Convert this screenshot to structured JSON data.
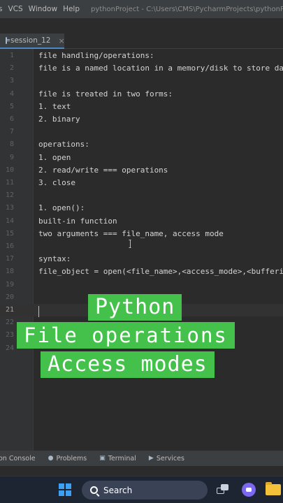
{
  "menu": {
    "items": [
      "s",
      "VCS",
      "Window",
      "Help"
    ],
    "title": "pythonProject - C:\\Users\\CMS\\PycharmProjects\\pythonProject"
  },
  "tab": {
    "label": "session_12",
    "close": "×"
  },
  "editor": {
    "lines": [
      {
        "num": "1",
        "code": "file handling/operations:"
      },
      {
        "num": "2",
        "code": "file is a named location in a memory/disk to store data"
      },
      {
        "num": "3",
        "code": ""
      },
      {
        "num": "4",
        "code": "file is treated in two forms:"
      },
      {
        "num": "5",
        "code": "1. text"
      },
      {
        "num": "6",
        "code": "2. binary"
      },
      {
        "num": "7",
        "code": ""
      },
      {
        "num": "8",
        "code": "operations:"
      },
      {
        "num": "9",
        "code": "1. open"
      },
      {
        "num": "10",
        "code": "2. read/write === operations"
      },
      {
        "num": "11",
        "code": "3. close"
      },
      {
        "num": "12",
        "code": ""
      },
      {
        "num": "13",
        "code": "1. open():"
      },
      {
        "num": "14",
        "code": "built-in function"
      },
      {
        "num": "15",
        "code": "two arguments === file_name, access mode"
      },
      {
        "num": "16",
        "code": ""
      },
      {
        "num": "17",
        "code": "syntax:"
      },
      {
        "num": "18",
        "code": "file_object = open(<file_name>,<access_mode>,<buffering>)"
      },
      {
        "num": "19",
        "code": ""
      },
      {
        "num": "20",
        "code": ""
      },
      {
        "num": "21",
        "code": ""
      },
      {
        "num": "22",
        "code": ""
      },
      {
        "num": "23",
        "code": ""
      },
      {
        "num": "24",
        "code": ""
      }
    ],
    "current_line": "21"
  },
  "overlay": {
    "line1": "Python",
    "line2": "File operations",
    "line3": "Access modes",
    "color": "#43c14a"
  },
  "toolwindows": [
    {
      "label": "on Console",
      "icon": "console-icon"
    },
    {
      "label": "Problems",
      "icon": "problems-icon"
    },
    {
      "label": "Terminal",
      "icon": "terminal-icon"
    },
    {
      "label": "Services",
      "icon": "services-icon"
    }
  ],
  "taskbar": {
    "search_label": "Search"
  }
}
